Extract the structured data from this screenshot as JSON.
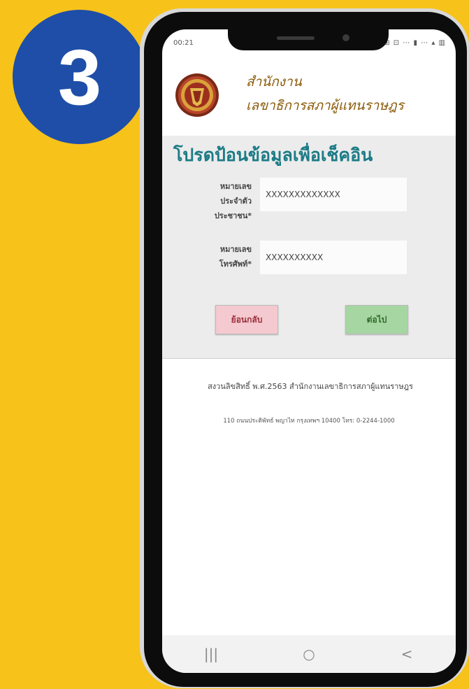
{
  "step_number": "3",
  "status_bar": {
    "time": "00:21",
    "icons": "⊞ ⊡ ⋯ ▮ ⋯ ▴ ▥"
  },
  "header": {
    "org_name_line1": "สำนักงาน",
    "org_name_line2": "เลขาธิการสภาผู้แทนราษฎร"
  },
  "form": {
    "title": "โปรดป้อนข้อมูลเพื่อเช็คอิน",
    "id_label_lines": [
      "หมายเลข",
      "ประจำตัว",
      "ประชาชน*"
    ],
    "id_value": "XXXXXXXXXXXXX",
    "phone_label_lines": [
      "หมายเลข",
      "โทรศัพท์*"
    ],
    "phone_value": "XXXXXXXXXX",
    "back_label": "ย้อนกลับ",
    "next_label": "ต่อไป"
  },
  "footer": {
    "copyright": "สงวนลิขสิทธิ์ พ.ศ.2563 สำนักงานเลขาธิการสภาผู้แทนราษฎร",
    "address": "110 ถนนประดิพัทธ์ พญาไท กรุงเทพฯ 10400 โทร: 0-2244-1000"
  },
  "nav": {
    "recent": "|||",
    "home": "○",
    "back": "<"
  },
  "colors": {
    "background": "#f7c21a",
    "step_circle": "#1e4ea8",
    "title": "#1c7b86",
    "back_button": "#f4c9cf",
    "next_button": "#a6d6a2"
  }
}
